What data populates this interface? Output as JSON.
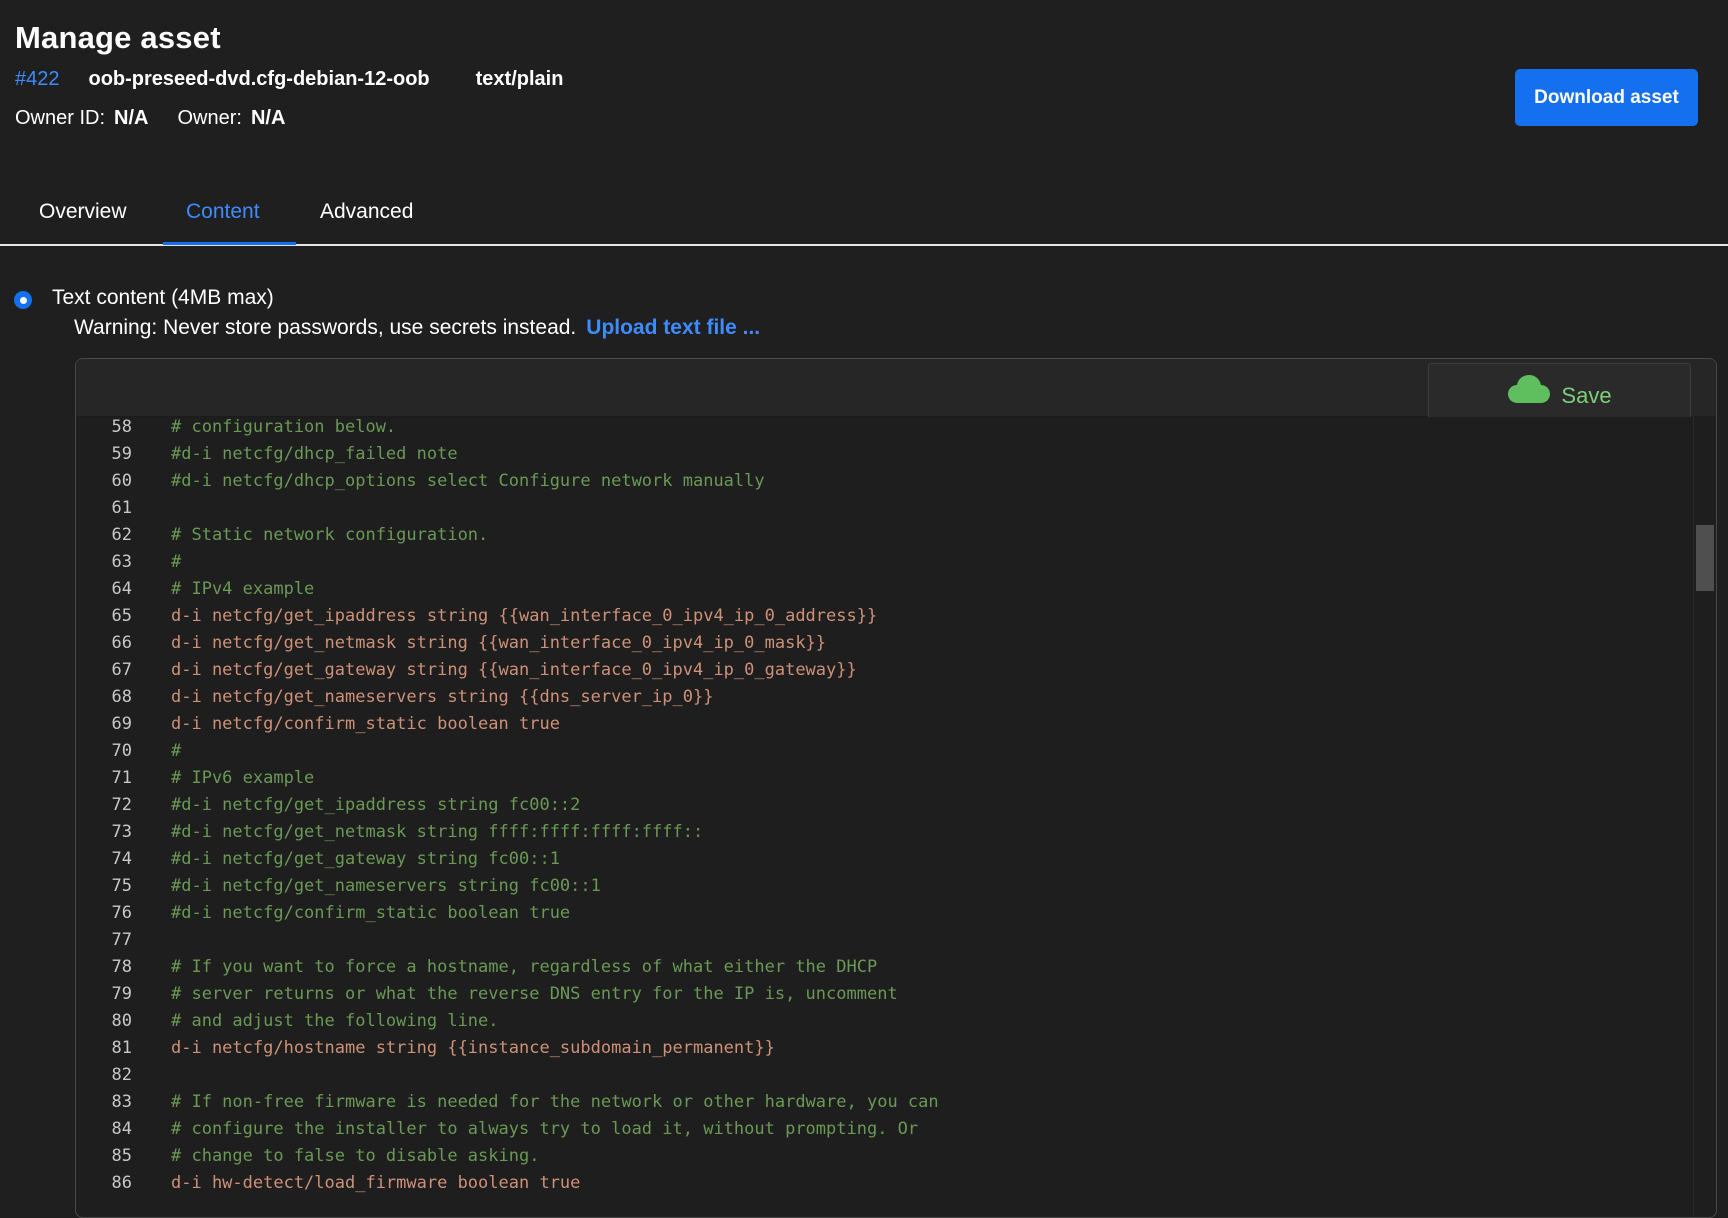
{
  "header": {
    "title": "Manage asset",
    "asset_id": "#422",
    "asset_name": "oob-preseed-dvd.cfg-debian-12-oob",
    "asset_type": "text/plain",
    "owner_id_label": "Owner ID:",
    "owner_id_value": "N/A",
    "owner_label": "Owner:",
    "owner_value": "N/A",
    "download_label": "Download asset"
  },
  "tabs": [
    {
      "label": "Overview",
      "active": false
    },
    {
      "label": "Content",
      "active": true
    },
    {
      "label": "Advanced",
      "active": false
    }
  ],
  "content": {
    "radio_label": "Text content (4MB max)",
    "warning": "Warning: Never store passwords, use secrets instead.",
    "upload_link": "Upload text file ...",
    "save_label": "Save",
    "save_icon": "cloud-icon"
  },
  "editor": {
    "lines": [
      {
        "n": "58",
        "text": "# configuration below.",
        "kind": "comment"
      },
      {
        "n": "59",
        "text": "#d-i netcfg/dhcp_failed note",
        "kind": "comment"
      },
      {
        "n": "60",
        "text": "#d-i netcfg/dhcp_options select Configure network manually",
        "kind": "comment"
      },
      {
        "n": "61",
        "text": "",
        "kind": "comment"
      },
      {
        "n": "62",
        "text": "# Static network configuration.",
        "kind": "comment"
      },
      {
        "n": "63",
        "text": "#",
        "kind": "comment"
      },
      {
        "n": "64",
        "text": "# IPv4 example",
        "kind": "comment"
      },
      {
        "n": "65",
        "text": "d-i netcfg/get_ipaddress string {{wan_interface_0_ipv4_ip_0_address}}",
        "kind": "directive"
      },
      {
        "n": "66",
        "text": "d-i netcfg/get_netmask string {{wan_interface_0_ipv4_ip_0_mask}}",
        "kind": "directive"
      },
      {
        "n": "67",
        "text": "d-i netcfg/get_gateway string {{wan_interface_0_ipv4_ip_0_gateway}}",
        "kind": "directive"
      },
      {
        "n": "68",
        "text": "d-i netcfg/get_nameservers string {{dns_server_ip_0}}",
        "kind": "directive"
      },
      {
        "n": "69",
        "text": "d-i netcfg/confirm_static boolean true",
        "kind": "directive"
      },
      {
        "n": "70",
        "text": "#",
        "kind": "comment"
      },
      {
        "n": "71",
        "text": "# IPv6 example",
        "kind": "comment"
      },
      {
        "n": "72",
        "text": "#d-i netcfg/get_ipaddress string fc00::2",
        "kind": "comment"
      },
      {
        "n": "73",
        "text": "#d-i netcfg/get_netmask string ffff:ffff:ffff:ffff::",
        "kind": "comment"
      },
      {
        "n": "74",
        "text": "#d-i netcfg/get_gateway string fc00::1",
        "kind": "comment"
      },
      {
        "n": "75",
        "text": "#d-i netcfg/get_nameservers string fc00::1",
        "kind": "comment"
      },
      {
        "n": "76",
        "text": "#d-i netcfg/confirm_static boolean true",
        "kind": "comment"
      },
      {
        "n": "77",
        "text": "",
        "kind": "comment"
      },
      {
        "n": "78",
        "text": "# If you want to force a hostname, regardless of what either the DHCP",
        "kind": "comment"
      },
      {
        "n": "79",
        "text": "# server returns or what the reverse DNS entry for the IP is, uncomment",
        "kind": "comment"
      },
      {
        "n": "80",
        "text": "# and adjust the following line.",
        "kind": "comment"
      },
      {
        "n": "81",
        "text": "d-i netcfg/hostname string {{instance_subdomain_permanent}}",
        "kind": "directive"
      },
      {
        "n": "82",
        "text": "",
        "kind": "comment"
      },
      {
        "n": "83",
        "text": "# If non-free firmware is needed for the network or other hardware, you can",
        "kind": "comment"
      },
      {
        "n": "84",
        "text": "# configure the installer to always try to load it, without prompting. Or",
        "kind": "comment"
      },
      {
        "n": "85",
        "text": "# change to false to disable asking.",
        "kind": "comment"
      },
      {
        "n": "86",
        "text": "d-i hw-detect/load_firmware boolean true",
        "kind": "directive"
      }
    ]
  },
  "colors": {
    "background": "#1f1f1f",
    "accent": "#1570ef",
    "link": "#3d8bff",
    "comment": "#6a9955",
    "directive": "#ce9178",
    "save": "#7dcf7d"
  }
}
